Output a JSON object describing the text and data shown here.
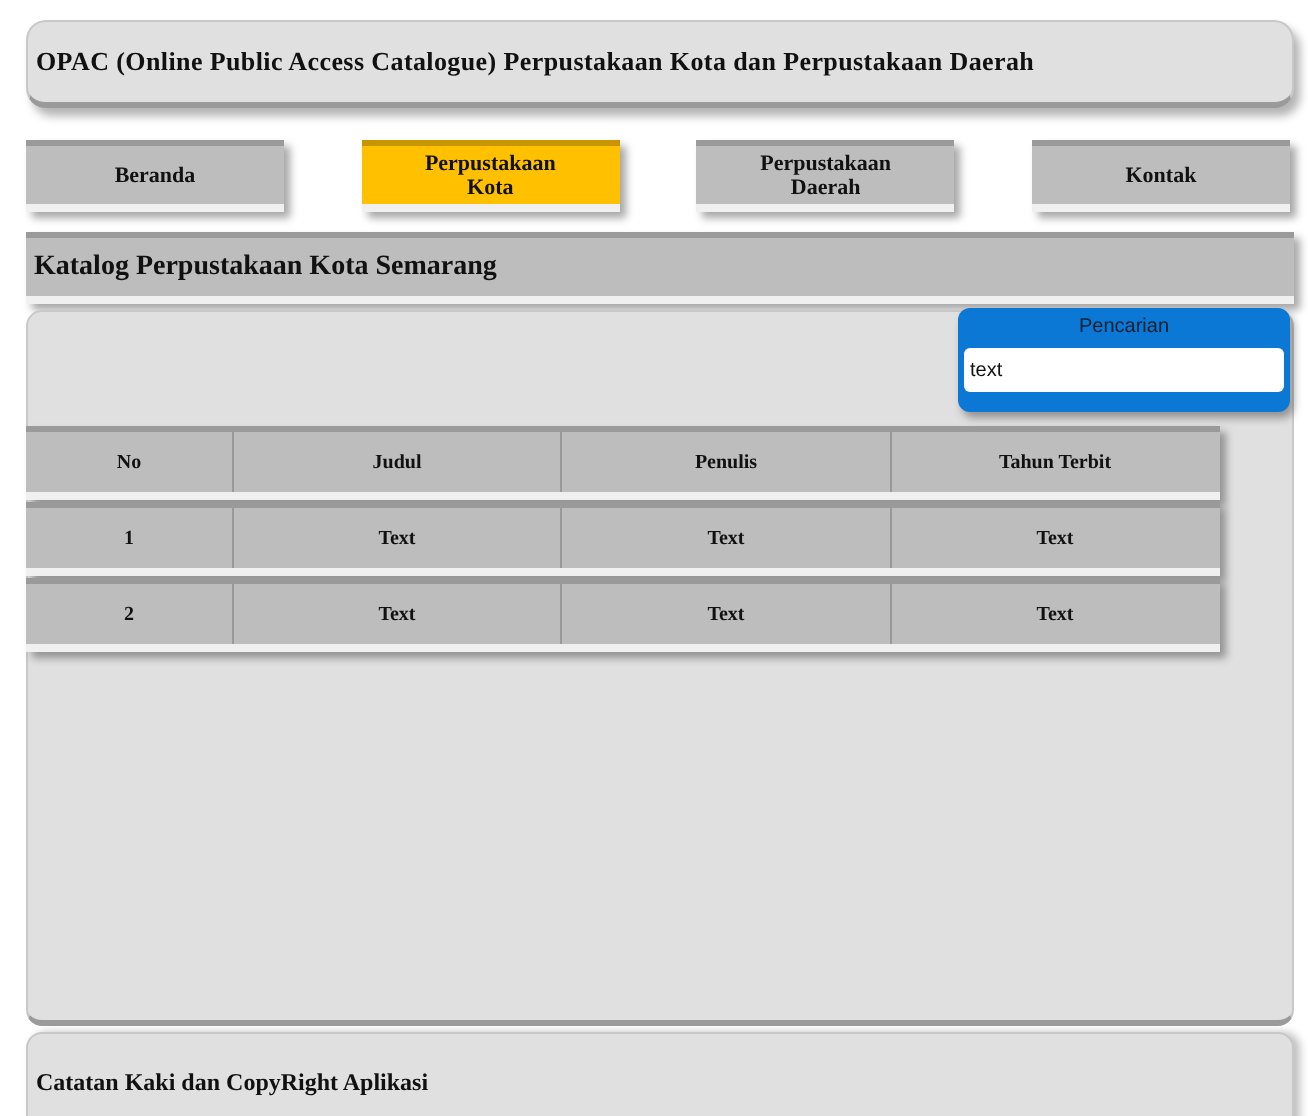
{
  "header": {
    "title": "OPAC (Online Public Access Catalogue) Perpustakaan Kota dan Perpustakaan Daerah"
  },
  "nav": [
    {
      "label": "Beranda",
      "selected": false
    },
    {
      "label": "Perpustakaan Kota",
      "selected": true
    },
    {
      "label": "Perpustakaan Daerah",
      "selected": false
    },
    {
      "label": "Kontak",
      "selected": false
    }
  ],
  "section_title": "Katalog Perpustakaan Kota Semarang",
  "search": {
    "title": "Pencarian",
    "value": "text"
  },
  "table": {
    "columns": [
      "No",
      "Judul",
      "Penulis",
      "Tahun Terbit"
    ],
    "rows": [
      [
        "1",
        "Text",
        "Text",
        "Text"
      ],
      [
        "2",
        "Text",
        "Text",
        "Text"
      ]
    ]
  },
  "footer": "Catatan Kaki dan CopyRight Aplikasi"
}
